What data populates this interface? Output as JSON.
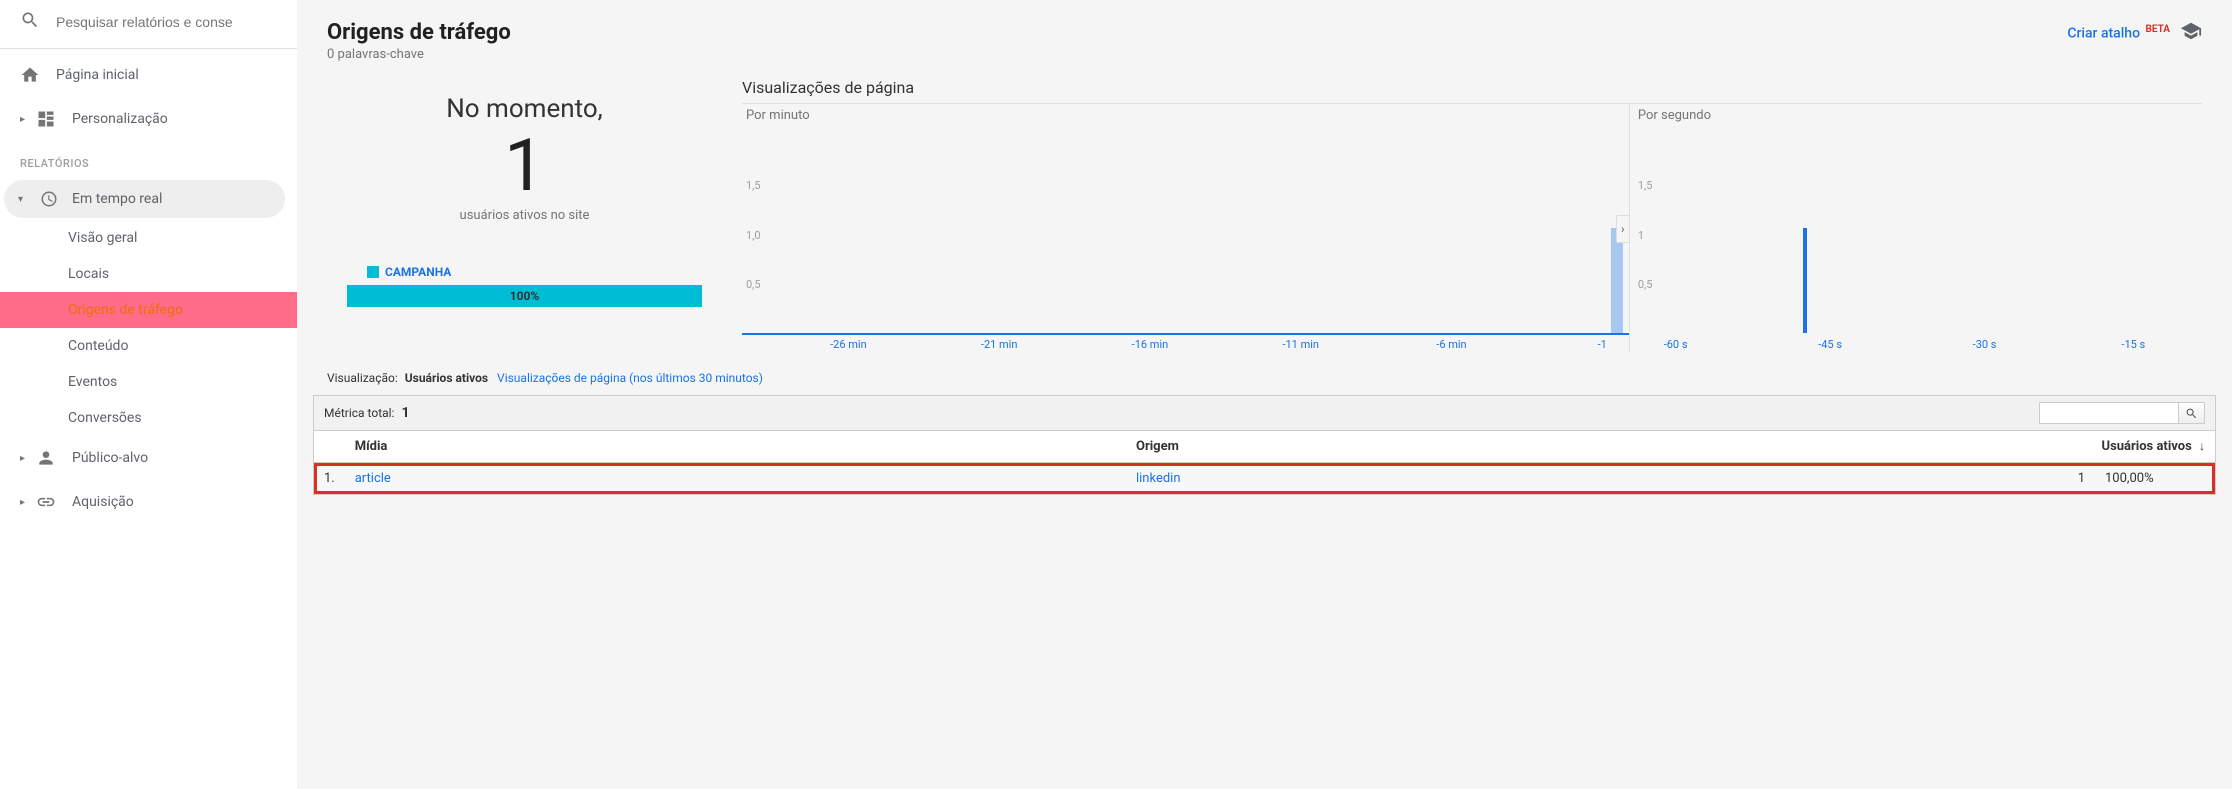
{
  "search": {
    "placeholder": "Pesquisar relatórios e conse"
  },
  "nav": {
    "home": "Página inicial",
    "custom": "Personalização",
    "section_reports": "RELATÓRIOS",
    "realtime": "Em tempo real",
    "sub": {
      "overview": "Visão geral",
      "locations": "Locais",
      "traffic": "Origens de tráfego",
      "content": "Conteúdo",
      "events": "Eventos",
      "conversions": "Conversões"
    },
    "audience": "Público-alvo",
    "acquisition": "Aquisição"
  },
  "header": {
    "title": "Origens de tráfego",
    "subtitle": "0 palavras-chave",
    "shortcut": "Criar atalho",
    "beta": "BETA"
  },
  "left_card": {
    "no_momento": "No momento,",
    "count": "1",
    "sub": "usuários ativos no site",
    "legend": "CAMPANHA",
    "bar_pct": "100%"
  },
  "charts": {
    "title": "Visualizações de página",
    "per_minute": "Por minuto",
    "per_second": "Por segundo",
    "y15": "1,5",
    "y10": "1,0",
    "y05": "0,5",
    "y1": "1",
    "min_ticks": [
      "-26 min",
      "-21 min",
      "-16 min",
      "-11 min",
      "-6 min",
      "-1"
    ],
    "sec_ticks": [
      "-60 s",
      "-45 s",
      "-30 s",
      "-15 s"
    ]
  },
  "toggle": {
    "label": "Visualização:",
    "active": "Usuários ativos",
    "link": "Visualizações de página (nos últimos 30 minutos)"
  },
  "table": {
    "metric_label": "Métrica total:",
    "metric_value": "1",
    "col_media": "Mídia",
    "col_origin": "Origem",
    "col_active": "Usuários ativos",
    "rows": [
      {
        "idx": "1.",
        "media": "article",
        "origin": "linkedin",
        "count": "1",
        "pct": "100,00%"
      }
    ]
  },
  "chart_data": {
    "type": "bar",
    "per_minute": {
      "title": "Por minuto",
      "ylim": [
        0,
        1.5
      ],
      "x_labels": [
        "-26 min",
        "-21 min",
        "-16 min",
        "-11 min",
        "-6 min",
        "-1"
      ],
      "bars": [
        {
          "x_minute": -1,
          "value": 1
        }
      ]
    },
    "per_second": {
      "title": "Por segundo",
      "ylim": [
        0,
        1.5
      ],
      "x_labels": [
        "-60 s",
        "-45 s",
        "-30 s",
        "-15 s"
      ],
      "bars": [
        {
          "x_second": -45,
          "value": 1
        }
      ]
    }
  }
}
